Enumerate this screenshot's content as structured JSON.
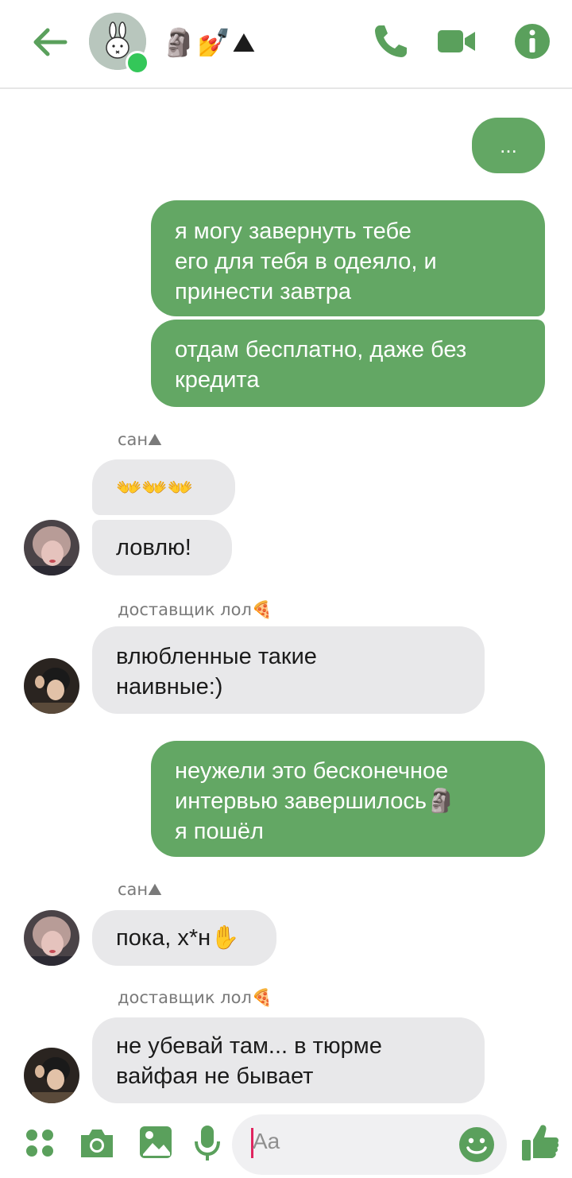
{
  "header": {
    "title_emoji": "🗿💅⛰",
    "icons": [
      "back-arrow-icon",
      "phone-icon",
      "video-camera-icon",
      "info-icon"
    ]
  },
  "messages": {
    "m1": "...",
    "m2_line1": "я могу завернуть тебе",
    "m2_line2": "его для тебя в одеяло, и",
    "m2_line3": "принести завтра",
    "m3_line1": "отдам бесплатно, даже без",
    "m3_line2": "кредита",
    "sender1": "сан⛰",
    "m4": "👐👐👐",
    "m5": "ловлю!",
    "sender2": "доставщик лол🍕",
    "m6_line1": "влюбленные такие",
    "m6_line2": "наивные:)",
    "m7_line1": "неужели это бесконечное",
    "m7_line2": "интервью завершилось🗿",
    "m7_line3": "я пошёл",
    "sender3": "сан⛰",
    "m8": "пока, х*н✋",
    "sender4": "доставщик лол🍕",
    "m9_line1": "не убевай там... в тюрме",
    "m9_line2": "вайфая не бывает"
  },
  "composer": {
    "placeholder": "Aa"
  },
  "colors": {
    "accent": "#63a764",
    "incoming_bubble": "#e8e8ea",
    "online": "#34c759"
  }
}
